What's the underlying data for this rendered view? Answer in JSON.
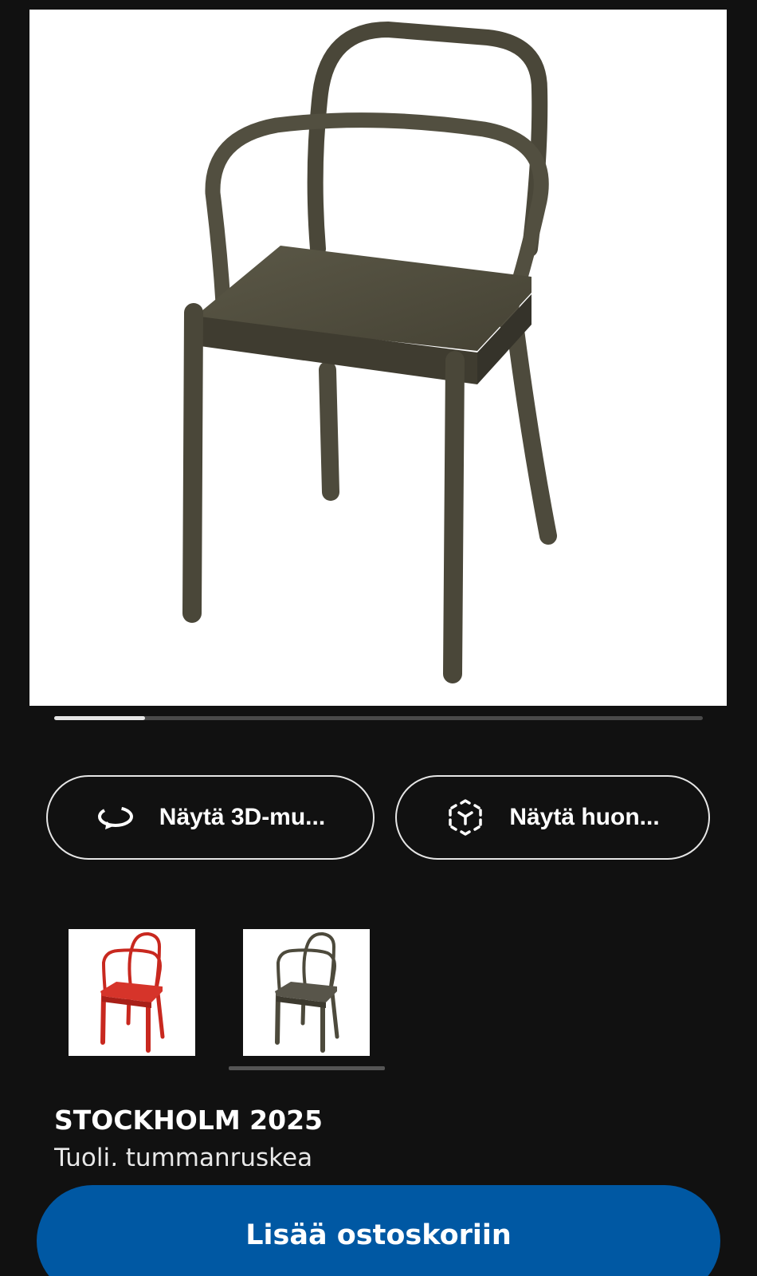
{
  "gallery": {
    "image_alt": "tuolin tuotekuva",
    "progress_fraction": 0.14
  },
  "actions": {
    "view_3d_label": "Näytä 3D-mu...",
    "view_3d_icon": "rotate-3d-icon",
    "view_room_label": "Näytä huon...",
    "view_room_icon": "ar-cube-icon"
  },
  "variants": [
    {
      "color_name": "punainen",
      "swatch": "#c8281f",
      "selected": false
    },
    {
      "color_name": "tummanruskea",
      "swatch": "#4d4a3c",
      "selected": true
    }
  ],
  "product": {
    "name": "STOCKHOLM 2025",
    "description": "Tuoli, tummanruskea"
  },
  "cart": {
    "label": "Lisää ostoskoriin",
    "color": "#0058a3"
  }
}
